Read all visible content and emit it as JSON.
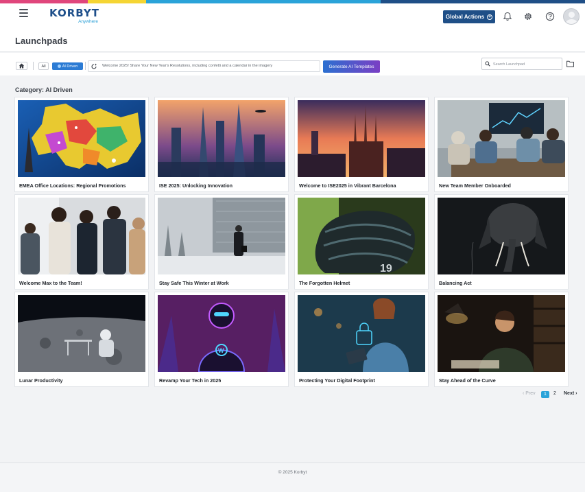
{
  "brand": {
    "logo_text": "KORBYT",
    "logo_sub": "Anywhere",
    "strip_colors": [
      "#e0467c",
      "#f5d533",
      "#2aa3d9",
      "#1f4f87"
    ],
    "accent": "#1f4f87"
  },
  "header": {
    "global_actions_label": "Global Actions",
    "icons": [
      "hamburger-icon",
      "bell-icon",
      "gear-icon",
      "help-icon",
      "avatar"
    ]
  },
  "page": {
    "title": "Launchpads"
  },
  "toolbar": {
    "filter_all": "All",
    "filter_ai": "AI Driven",
    "prompt_text": "Welcome 2025! Share Your New Year's Resolutions, including confetti and a calendar in the imagery",
    "generate_label": "Generate AI Templates",
    "search_placeholder": "Search Launchpad"
  },
  "category_label": "Category: AI Driven",
  "cards": [
    {
      "title": "EMEA Office Locations: Regional Promotions"
    },
    {
      "title": "ISE 2025: Unlocking Innovation"
    },
    {
      "title": "Welcome to ISE2025 in Vibrant Barcelona"
    },
    {
      "title": "New Team Member Onboarded"
    },
    {
      "title": "Welcome Max to the Team!"
    },
    {
      "title": "Stay Safe This Winter at Work"
    },
    {
      "title": "The Forgotten Helmet"
    },
    {
      "title": "Balancing Act"
    },
    {
      "title": "Lunar Productivity"
    },
    {
      "title": "Revamp Your Tech in 2025"
    },
    {
      "title": "Protecting Your Digital Footprint"
    },
    {
      "title": "Stay Ahead of the Curve"
    }
  ],
  "pagination": {
    "prev": "‹ Prev",
    "pages": [
      "1",
      "2"
    ],
    "current": "1",
    "next": "Next ›"
  },
  "footer": {
    "text": "© 2025 Korbyt"
  }
}
